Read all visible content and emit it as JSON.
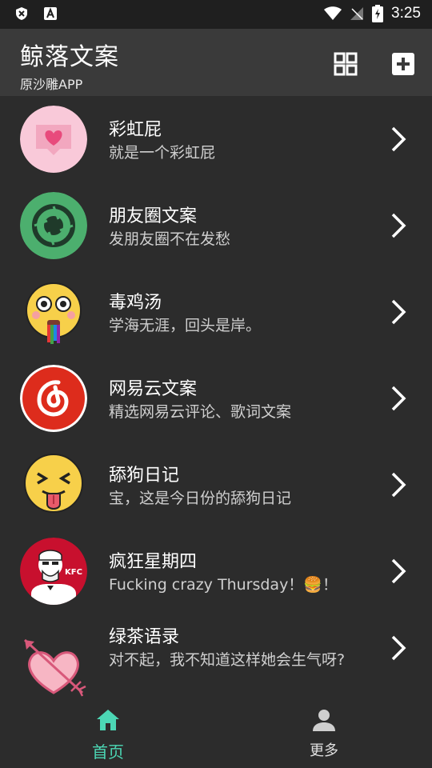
{
  "status_bar": {
    "time": "3:25"
  },
  "app_bar": {
    "title": "鲸落文案",
    "subtitle": "原沙雕APP",
    "accent": "#4cd7b5"
  },
  "list": [
    {
      "title": "彩虹屁",
      "subtitle": "就是一个彩虹屁",
      "icon": "heart-chat-icon"
    },
    {
      "title": "朋友圈文案",
      "subtitle": "发朋友圈不在发愁",
      "icon": "camera-aperture-icon"
    },
    {
      "title": "毒鸡汤",
      "subtitle": "学海无涯，回头是岸。",
      "icon": "rainbow-puke-emoji-icon"
    },
    {
      "title": "网易云文案",
      "subtitle": "精选网易云评论、歌词文案",
      "icon": "netease-music-icon"
    },
    {
      "title": "舔狗日记",
      "subtitle": "宝，这是今日份的舔狗日记",
      "icon": "tongue-out-emoji-icon"
    },
    {
      "title": "疯狂星期四",
      "subtitle": "Fucking crazy Thursday！🍔！",
      "icon": "kfc-logo-icon"
    },
    {
      "title": "绿茶语录",
      "subtitle": "对不起，我不知道这样她会生气呀?",
      "icon": "arrow-heart-icon"
    }
  ],
  "bottom_nav": {
    "home_label": "首页",
    "more_label": "更多"
  }
}
